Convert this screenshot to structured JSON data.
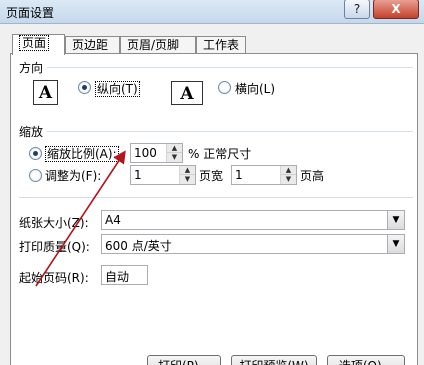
{
  "window": {
    "title": "页面设置",
    "help_label": "?",
    "close_label": "X"
  },
  "tabs": [
    {
      "label": "页面",
      "active": true
    },
    {
      "label": "页边距"
    },
    {
      "label": "页眉/页脚"
    },
    {
      "label": "工作表"
    }
  ],
  "orientation": {
    "group_label": "方向",
    "icon_letter": "A",
    "portrait_label": "纵向(T)",
    "landscape_label": "横向(L)",
    "selected": "portrait"
  },
  "scaling": {
    "group_label": "缩放",
    "adjust_label": "缩放比例(A):",
    "adjust_value": "100",
    "adjust_suffix": "% 正常尺寸",
    "fit_label": "调整为(F):",
    "fit_wide_value": "1",
    "fit_wide_suffix": "页宽",
    "fit_tall_value": "1",
    "fit_tall_suffix": "页高",
    "selected": "adjust"
  },
  "paper": {
    "size_label": "纸张大小(Z):",
    "size_value": "A4",
    "quality_label": "打印质量(Q):",
    "quality_value": "600 点/英寸",
    "first_page_label": "起始页码(R):",
    "first_page_value": "自动"
  },
  "buttons": {
    "print": "打印(P)...",
    "preview": "打印预览(W)",
    "options": "选项(O)..."
  },
  "annotation": {
    "arrow_color": "#b3141e"
  }
}
